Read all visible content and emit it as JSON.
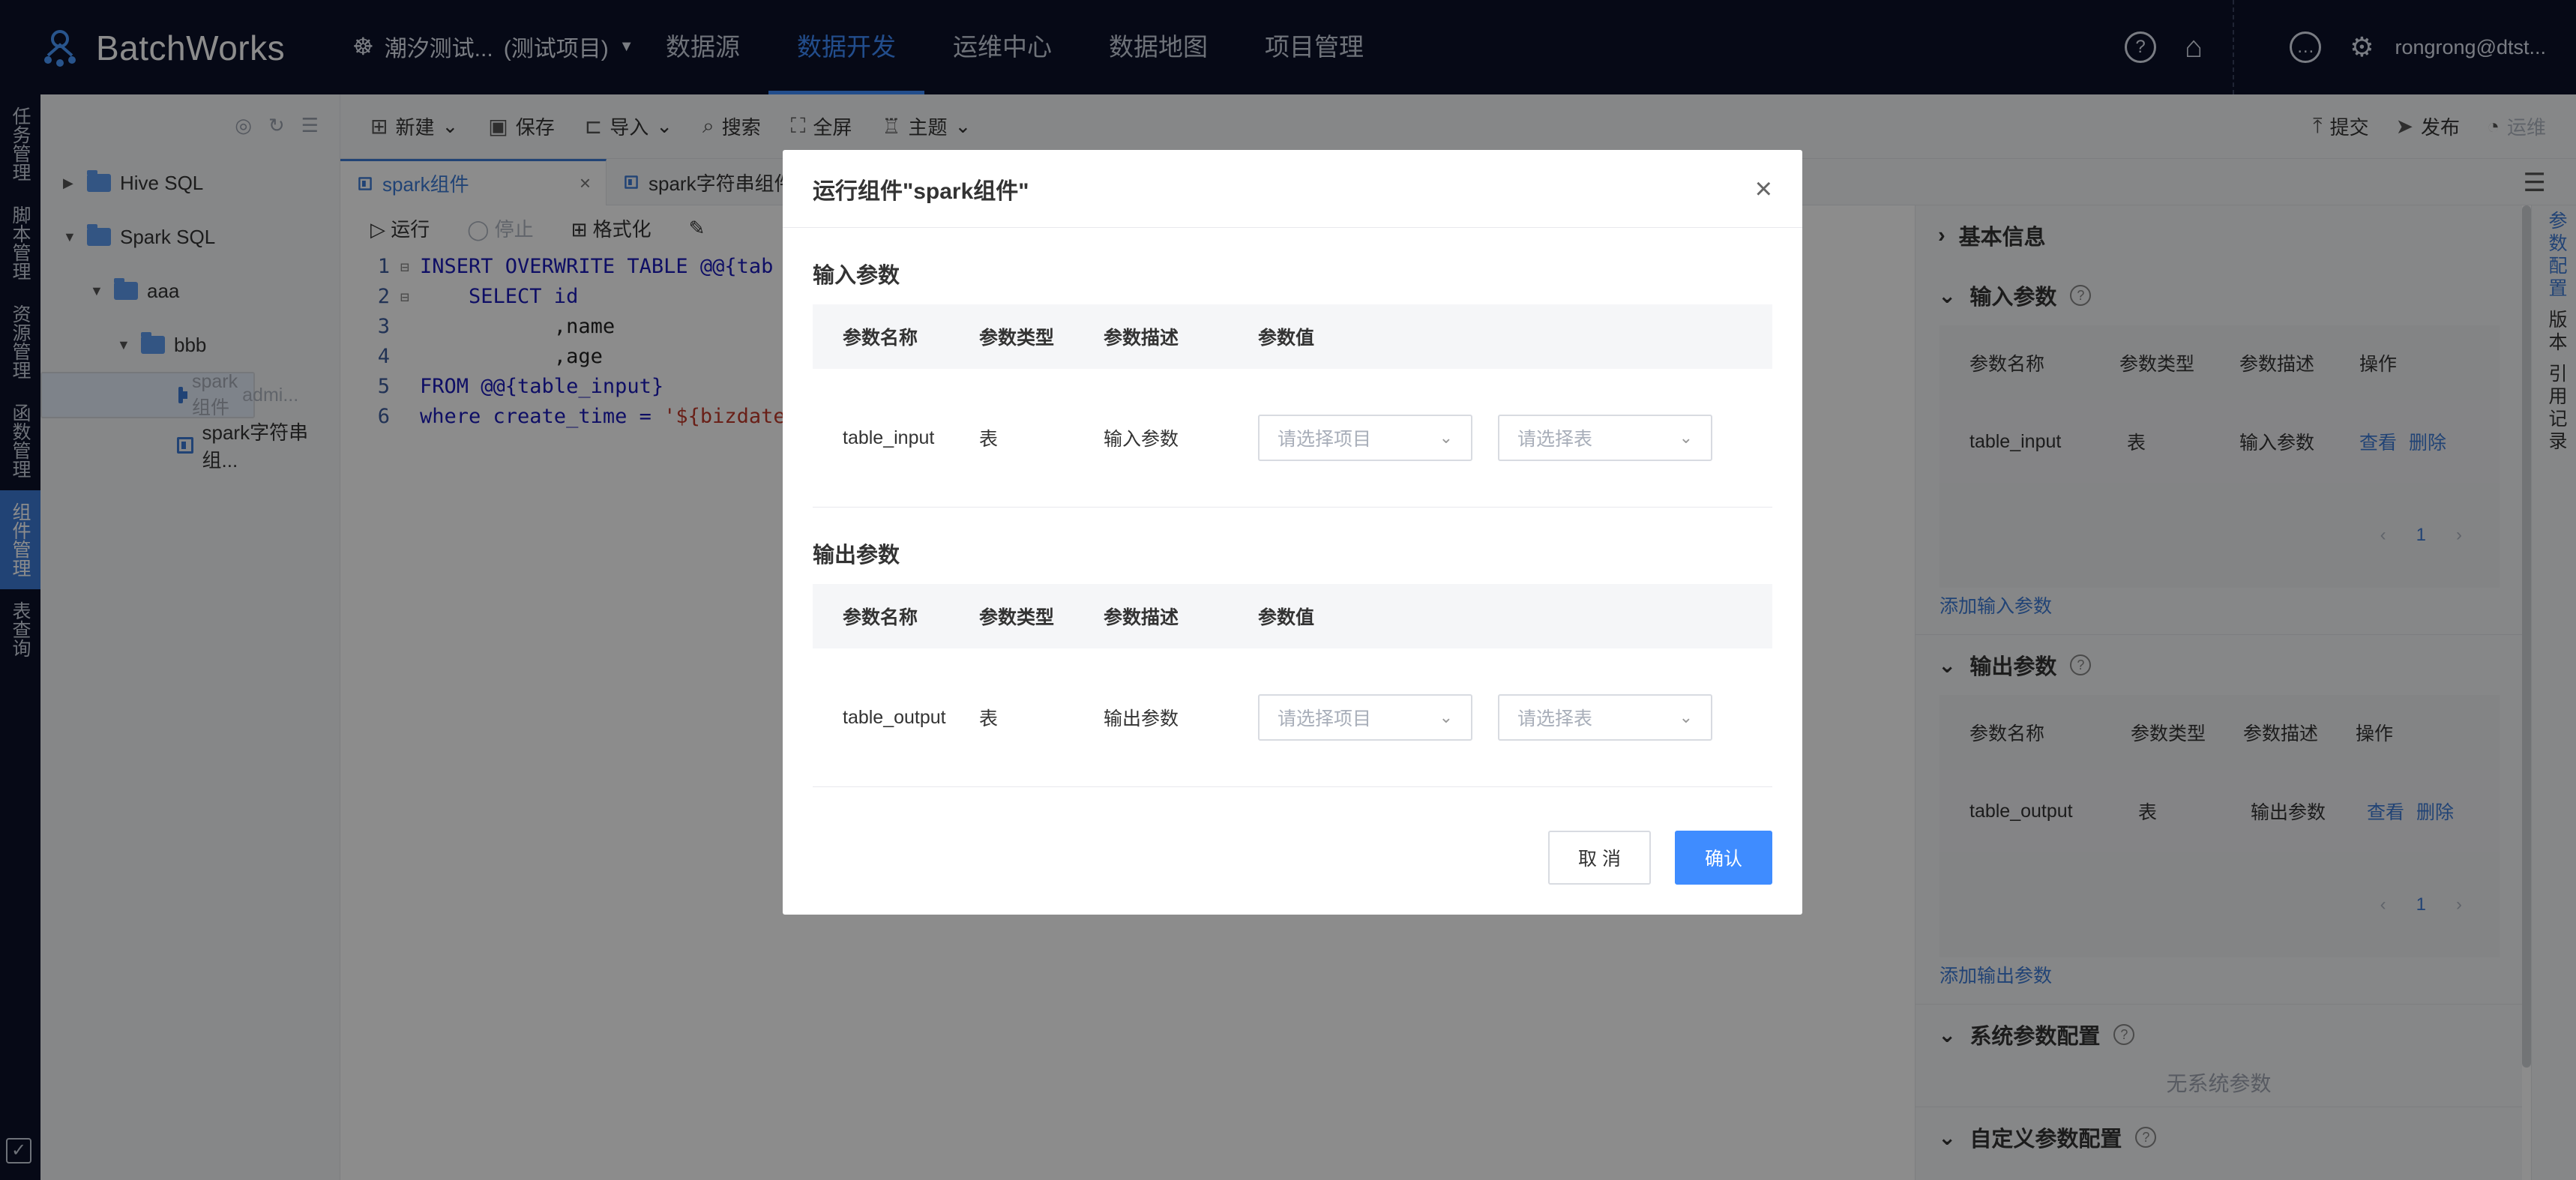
{
  "app": {
    "name": "BatchWorks"
  },
  "nav": {
    "project": "潮汐测试...",
    "project_tag": "(测试项目)",
    "links": [
      "数据源",
      "数据开发",
      "运维中心",
      "数据地图",
      "项目管理"
    ],
    "user": "rongrong@dtst..."
  },
  "vmenu": [
    "任务管理",
    "脚本管理",
    "资源管理",
    "函数管理",
    "组件管理",
    "表查询"
  ],
  "tree": [
    {
      "label": "Hive SQL"
    },
    {
      "label": "Spark SQL"
    },
    {
      "label": "aaa"
    },
    {
      "label": "bbb"
    },
    {
      "label": "spark组件",
      "suffix": "admi..."
    },
    {
      "label": "spark字符串组..."
    }
  ],
  "toolbar": {
    "new": "新建",
    "save": "保存",
    "import": "导入",
    "search": "搜索",
    "fullscreen": "全屏",
    "theme": "主题",
    "submit": "提交",
    "publish": "发布",
    "ops": "运维"
  },
  "tabs": [
    "spark组件",
    "spark字符串组件"
  ],
  "subbar": {
    "run": "运行",
    "stop": "停止",
    "format": "格式化"
  },
  "code": {
    "lines": [
      {
        "n": "1",
        "text": "INSERT OVERWRITE TABLE @@{tab"
      },
      {
        "n": "2",
        "text": "    SELECT id"
      },
      {
        "n": "3",
        "text": "           ,name"
      },
      {
        "n": "4",
        "text": "           ,age"
      },
      {
        "n": "5",
        "text": "FROM @@{table_input}"
      },
      {
        "n": "6",
        "text": "where create_time = ",
        "str": "'${bizdate"
      }
    ]
  },
  "right_panel": {
    "basic": "基本信息",
    "input_title": "输入参数",
    "input_headers": [
      "参数名称",
      "参数类型",
      "参数描述",
      "操作"
    ],
    "input_row": [
      "table_input",
      "表",
      "输入参数"
    ],
    "view": "查看",
    "delete": "删除",
    "page": "1",
    "add_input": "添加输入参数",
    "output_title": "输出参数",
    "output_row": [
      "table_output",
      "表",
      "输出参数"
    ],
    "add_output": "添加输出参数",
    "sys_title": "系统参数配置",
    "sys_empty": "无系统参数",
    "custom_title": "自定义参数配置"
  },
  "vtabs": [
    "参数配置",
    "版本",
    "引用记录"
  ],
  "modal": {
    "title": "运行组件\"spark组件\"",
    "input_section": "输入参数",
    "output_section": "输出参数",
    "headers": [
      "参数名称",
      "参数类型",
      "参数描述",
      "参数值"
    ],
    "input_row": {
      "name": "table_input",
      "type": "表",
      "desc": "输入参数"
    },
    "output_row": {
      "name": "table_output",
      "type": "表",
      "desc": "输出参数"
    },
    "select_project_placeholder": "请选择项目",
    "select_table_placeholder": "请选择表",
    "cancel": "取 消",
    "confirm": "确认"
  }
}
